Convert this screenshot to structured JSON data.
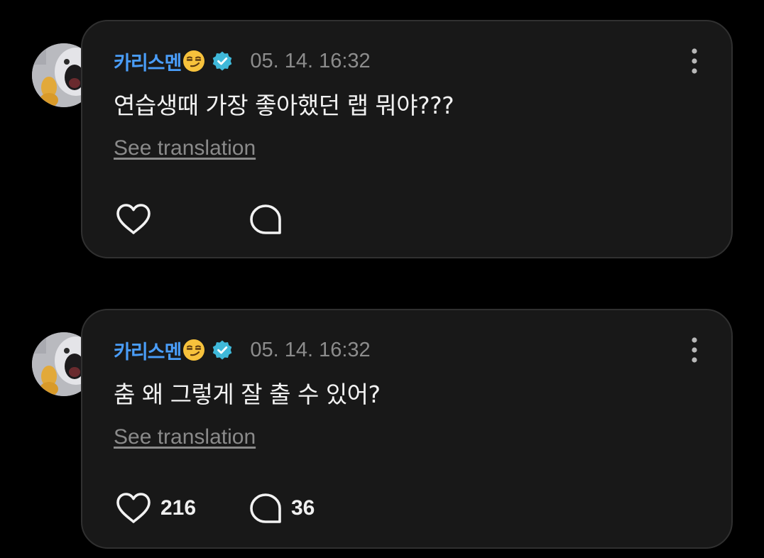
{
  "posts": [
    {
      "username": "카리스멘",
      "emoji": "smirking-face-emoji",
      "verified_icon": "verified-badge-icon",
      "timestamp": "05. 14. 16:32",
      "text": "연습생때 가장 좋아했던 랩 뭐야???",
      "translate_label": "See translation",
      "like_count": "",
      "comment_count": ""
    },
    {
      "username": "카리스멘",
      "emoji": "smirking-face-emoji",
      "verified_icon": "verified-badge-icon",
      "timestamp": "05. 14. 16:32",
      "text": "춤 왜 그렇게 잘 출 수 있어?",
      "translate_label": "See translation",
      "like_count": "216",
      "comment_count": "36"
    }
  ],
  "icons": {
    "like": "heart-icon",
    "comment": "speech-bubble-icon",
    "more": "more-vertical-icon"
  },
  "colors": {
    "background": "#000000",
    "card": "#181818",
    "card_border": "#303030",
    "username": "#4a9df8",
    "verified": "#3fb8d9",
    "muted_text": "#8c8c8c",
    "text": "#f2f2f2"
  }
}
